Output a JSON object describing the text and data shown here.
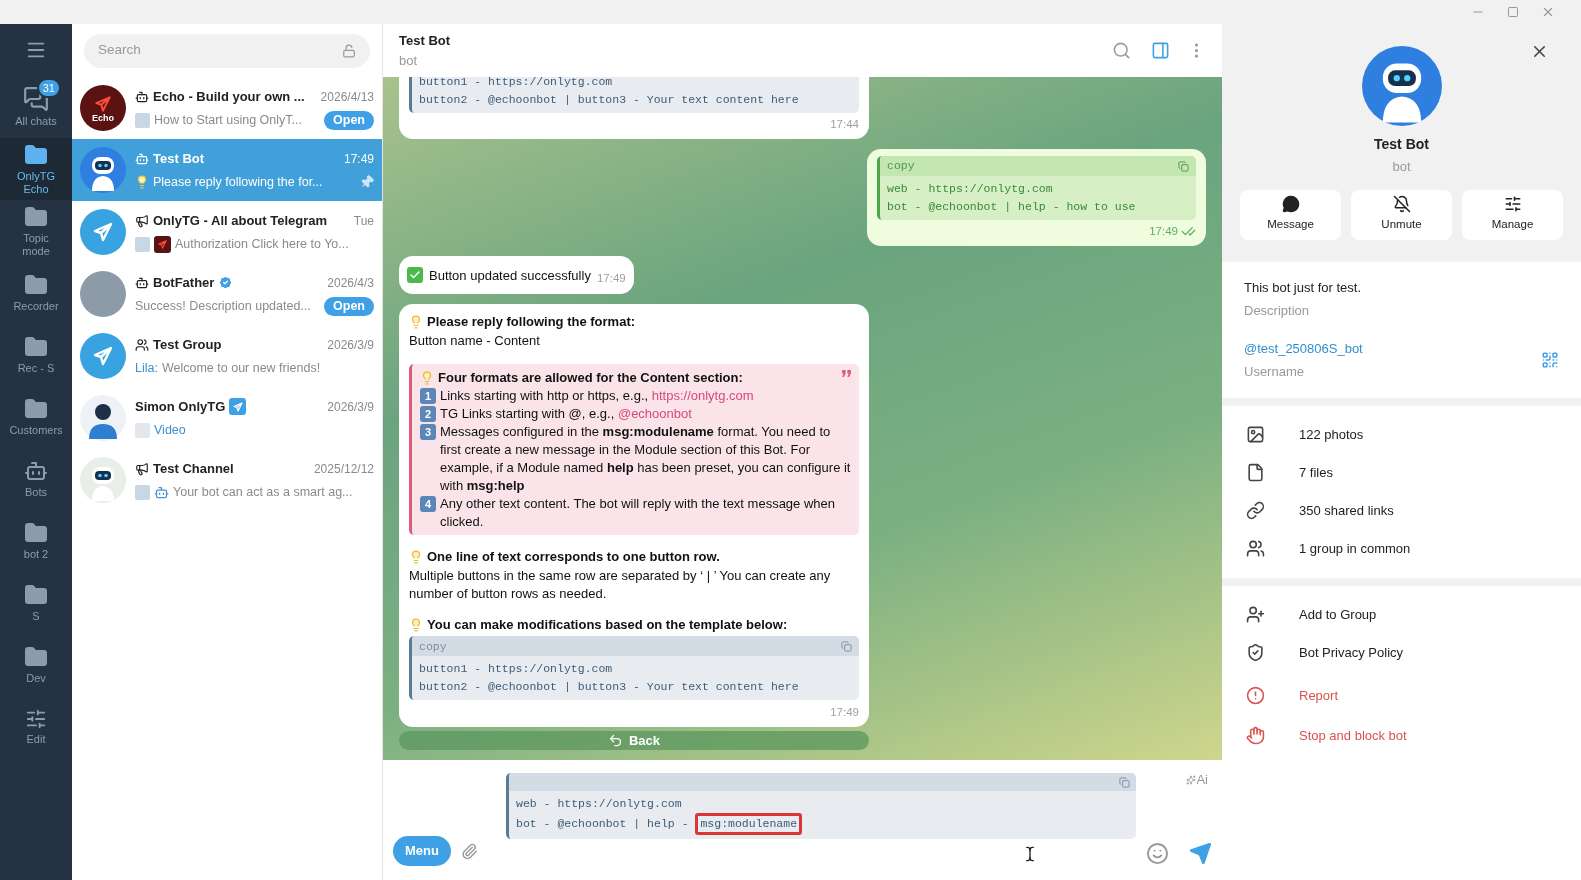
{
  "folders": [
    {
      "kind": "chats",
      "label": "All chats",
      "badge": "31",
      "selected": false
    },
    {
      "kind": "folder",
      "label": "OnlyTG Echo",
      "selected": true
    },
    {
      "kind": "folder",
      "label": "Topic mode",
      "selected": false
    },
    {
      "kind": "folder",
      "label": "Recorder",
      "selected": false
    },
    {
      "kind": "folder",
      "label": "Rec - S",
      "selected": false
    },
    {
      "kind": "folder",
      "label": "Customers",
      "selected": false
    },
    {
      "kind": "bots",
      "label": "Bots",
      "selected": false
    },
    {
      "kind": "folder",
      "label": "bot 2",
      "selected": false
    },
    {
      "kind": "folder",
      "label": "S",
      "selected": false
    },
    {
      "kind": "folder",
      "label": "Dev",
      "selected": false
    },
    {
      "kind": "edit",
      "label": "Edit",
      "selected": false
    }
  ],
  "search": {
    "placeholder": "Search"
  },
  "chats": [
    {
      "kind": "bot",
      "avatar": {
        "kind": "echo",
        "text": "Echo"
      },
      "name": "Echo - Build your own ...",
      "date": "2026/4/13",
      "thumbnails": [
        {
          "kind": "photo"
        }
      ],
      "preview": "How to Start using OnlyT...",
      "open_button": "Open",
      "pinned": false,
      "selected": false
    },
    {
      "kind": "bot",
      "avatar": {
        "kind": "robot"
      },
      "name": "Test Bot",
      "date": "17:49",
      "bulb": true,
      "preview": "Please reply following the for...",
      "pinned": true,
      "selected": true
    },
    {
      "kind": "channel",
      "avatar": {
        "kind": "plane"
      },
      "name": "OnlyTG - All about Telegram",
      "date": "Tue",
      "thumbnails": [
        {
          "kind": "photo"
        },
        {
          "kind": "logo"
        }
      ],
      "preview": "Authorization Click here to Yo...",
      "pinned": false,
      "selected": false
    },
    {
      "kind": "bot",
      "avatar": {
        "kind": "photo"
      },
      "name": "BotFather",
      "verified": true,
      "date": "2026/4/3",
      "preview": "Success! Description updated...",
      "open_button": "Open",
      "pinned": false,
      "selected": false
    },
    {
      "kind": "group",
      "avatar": {
        "kind": "plane"
      },
      "name": "Test Group",
      "date": "2026/3/9",
      "sender": "Lila:",
      "preview": "Welcome to our new friends!",
      "pinned": false,
      "selected": false
    },
    {
      "kind": "user",
      "avatar": {
        "kind": "person"
      },
      "name": "Simon OnlyTG",
      "name_badge": true,
      "date": "2026/3/9",
      "thumbnails": [
        {
          "kind": "video"
        }
      ],
      "preview": "Video",
      "preview_accent": true,
      "pinned": false,
      "selected": false
    },
    {
      "kind": "channel",
      "avatar": {
        "kind": "robot2"
      },
      "name": "Test Channel",
      "date": "2025/12/12",
      "thumbnails": [
        {
          "kind": "photo"
        },
        {
          "kind": "robot"
        }
      ],
      "preview": "Your bot can act as a smart ag...",
      "pinned": false,
      "selected": false
    }
  ],
  "header": {
    "title": "Test Bot",
    "subtitle": "bot",
    "panel_open": true
  },
  "messages": [
    {
      "kind": "code",
      "outgoing": false,
      "cut": true,
      "code": {
        "lines": [
          "button1 - https://onlytg.com",
          "button2 - @echoonbot | button3 - Your text content here"
        ]
      },
      "time": "17:44"
    },
    {
      "kind": "code",
      "outgoing": true,
      "read": true,
      "code": {
        "header": "copy",
        "lines": [
          "web - https://onlytg.com",
          "bot - @echoonbot | help - how to use"
        ]
      },
      "time": "17:49"
    },
    {
      "kind": "success",
      "outgoing": false,
      "text": "Button updated successfully",
      "time": "17:49"
    },
    {
      "kind": "rich",
      "outgoing": false,
      "time": "17:49",
      "blocks": [
        {
          "kind": "heading",
          "text": "Please reply following the format:"
        },
        {
          "kind": "text",
          "text": "Button name - Content"
        },
        {
          "kind": "quote",
          "heading": "Four formats are allowed for the Content section:",
          "items": [
            {
              "number": "1",
              "text": "Links starting with http or https, e.g., ",
              "link": "https://onlytg.com"
            },
            {
              "number": "2",
              "text": "TG Links starting with @, e.g., ",
              "link": "@echoonbot"
            },
            {
              "number": "3",
              "text": "Messages configured in the **msg:modulename** format. You need to first create a new message in the Module section of this Bot. For example, if a Module named **help** has been preset, you can configure it with **msg:help**"
            },
            {
              "number": "4",
              "text": "Any other text content. The bot will reply with the text message when clicked."
            }
          ]
        },
        {
          "kind": "heading",
          "text": "One line of text corresponds to one button row."
        },
        {
          "kind": "text",
          "text": "Multiple buttons in the same row are separated by ‘ | ’ You can create any number of button rows as needed."
        },
        {
          "kind": "heading",
          "text": "You can make modifications based on the template below:"
        },
        {
          "kind": "code",
          "header": "copy",
          "lines": [
            "button1 - https://onlytg.com",
            "button2 - @echoonbot | button3 - Your text content here"
          ]
        }
      ]
    }
  ],
  "keyboard": [
    {
      "label": "Back"
    }
  ],
  "composer": {
    "lines": [
      {
        "text": "web - https://onlytg.com"
      },
      {
        "text": "bot - @echoonbot | help - ",
        "highlight": "msg:modulename"
      }
    ],
    "menu_button": "Menu",
    "ai_label": "Ai"
  },
  "profile": {
    "name": "Test Bot",
    "subtitle": "bot",
    "actions": [
      {
        "kind": "message",
        "label": "Message"
      },
      {
        "kind": "unmute",
        "label": "Unmute"
      },
      {
        "kind": "manage",
        "label": "Manage"
      }
    ],
    "description": {
      "value": "This bot just for test.",
      "label": "Description"
    },
    "username": {
      "value": "@test_250806S_bot",
      "label": "Username"
    },
    "media": [
      {
        "kind": "photos",
        "label": "122 photos"
      },
      {
        "kind": "files",
        "label": "7 files"
      },
      {
        "kind": "links",
        "label": "350 shared links"
      },
      {
        "kind": "groups",
        "label": "1 group in common"
      }
    ],
    "options": [
      {
        "kind": "add",
        "label": "Add to Group",
        "danger": false
      },
      {
        "kind": "privacy",
        "label": "Bot Privacy Policy",
        "danger": false
      },
      {
        "kind": "report",
        "label": "Report",
        "danger": true
      },
      {
        "kind": "block",
        "label": "Stop and block bot",
        "danger": true
      }
    ]
  }
}
